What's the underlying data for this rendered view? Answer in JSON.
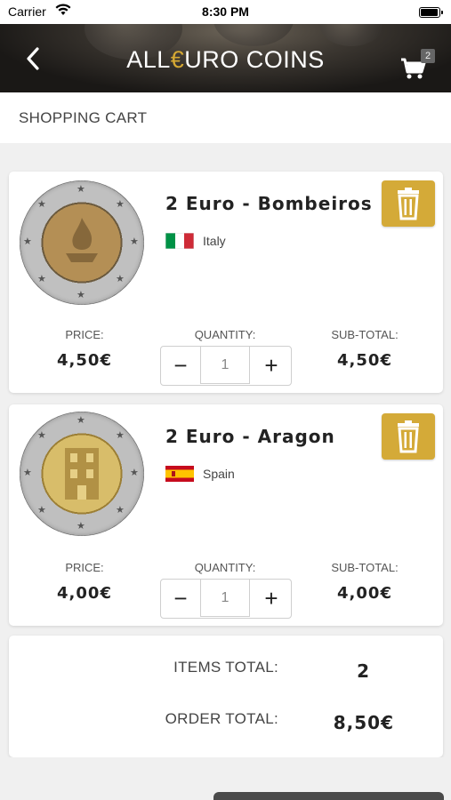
{
  "status_bar": {
    "carrier": "Carrier",
    "time": "8:30 PM"
  },
  "header": {
    "logo_prefix": "ALL",
    "logo_euro": "€",
    "logo_suffix": "URO COINS",
    "cart_count": "2"
  },
  "page": {
    "title": "SHOPPING CART"
  },
  "labels": {
    "price": "PRICE:",
    "quantity": "QUANTITY:",
    "subtotal": "SUB-TOTAL:"
  },
  "cart_items": [
    {
      "name": "2 Euro - Bombeiros",
      "country": "Italy",
      "price": "4,50€",
      "quantity": "1",
      "subtotal": "4,50€"
    },
    {
      "name": "2 Euro - Aragon",
      "country": "Spain",
      "price": "4,00€",
      "quantity": "1",
      "subtotal": "4,00€"
    }
  ],
  "totals": {
    "items_label": "ITEMS TOTAL:",
    "items_value": "2",
    "order_label": "ORDER TOTAL:",
    "order_value": "8,50€"
  },
  "colors": {
    "accent_gold": "#d4aa38",
    "header_dark": "#1d1b19"
  }
}
